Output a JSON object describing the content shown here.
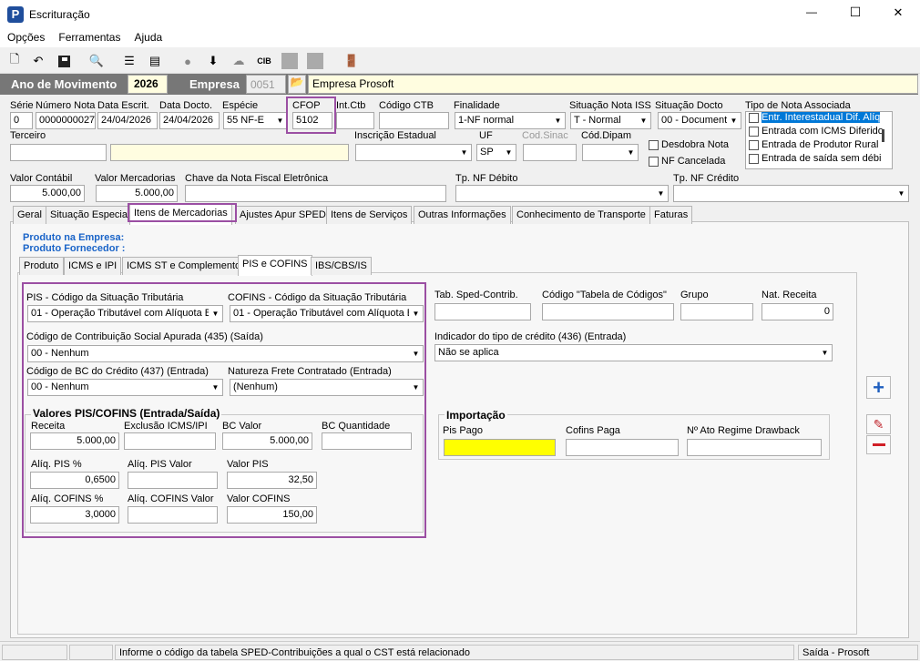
{
  "window": {
    "title": "Escrituração",
    "app_icon_letter": "P",
    "minimize": "—",
    "maximize": "☐",
    "close": "✕"
  },
  "menu": [
    "Opções",
    "Ferramentas",
    "Ajuda"
  ],
  "toolbar_icons": [
    "new-document-icon",
    "undo-icon",
    "save-icon",
    "print-preview-icon",
    "tree-icon",
    "report-icon",
    "apple-icon",
    "download-icon",
    "cloud-icon",
    "cib-icon",
    "panel-icon",
    "square-icon",
    "exit-door-icon"
  ],
  "header": {
    "ano_label": "Ano de Movimento",
    "ano_value": "2026",
    "empresa_label": "Empresa",
    "empresa_code": "0051",
    "empresa_name": "Empresa Prosoft"
  },
  "doc": {
    "serie_label": "Série",
    "serie": "0",
    "numero_label": "Número Nota",
    "numero": "0000000027",
    "data_escrit_label": "Data Escrit.",
    "data_escrit": "24/04/2026",
    "data_docto_label": "Data Docto.",
    "data_docto": "24/04/2026",
    "especie_label": "Espécie",
    "especie": "55   NF-E",
    "cfop_label": "CFOP",
    "cfop": "5102",
    "intctb_label": "Int.Ctb",
    "intctb": "",
    "codctb_label": "Código CTB",
    "codctb": "",
    "finalidade_label": "Finalidade",
    "finalidade": "1-NF normal",
    "situacao_iss_label": "Situação Nota ISS",
    "situacao_iss": "T - Normal",
    "situacao_docto_label": "Situação Docto",
    "situacao_docto": "00 - Document",
    "tipo_nota_label": "Tipo de Nota Associada",
    "tipo_nota_items": [
      "Entr. Interestadual Dif. Alíq",
      "Entrada com ICMS Diferido",
      "Entrada de Produtor Rural",
      "Entrada de saída sem débi"
    ],
    "terceiro_label": "Terceiro",
    "inscricao_label": "Inscrição Estadual",
    "uf_label": "UF",
    "uf": "SP",
    "codsinac_label": "Cod.Sinac",
    "coddipam_label": "Cód.Dipam",
    "desdobra_label": "Desdobra Nota",
    "cancelada_label": "NF Cancelada",
    "valor_contabil_label": "Valor Contábil",
    "valor_contabil": "5.000,00",
    "valor_merc_label": "Valor Mercadorias",
    "valor_merc": "5.000,00",
    "chave_label": "Chave da Nota Fiscal Eletrônica",
    "tp_debito_label": "Tp. NF Débito",
    "tp_credito_label": "Tp. NF Crédito"
  },
  "main_tabs": [
    "Geral",
    "Situação Especial",
    "Itens de Mercadorias",
    "Ajustes Apur SPED",
    "Itens de Serviços",
    "Outras Informações",
    "Conhecimento de Transporte",
    "Faturas"
  ],
  "produto_empresa": "Produto na Empresa:",
  "produto_fornecedor": "Produto Fornecedor :",
  "sub_tabs": [
    "Produto",
    "ICMS e IPI",
    "ICMS ST e Complemento",
    "PIS e COFINS",
    "IBS/CBS/IS"
  ],
  "pis": {
    "pis_cst_label": "PIS - Código da Situação Tributária",
    "pis_cst": "01 - Operação Tributável com Alíquota B",
    "cofins_cst_label": "COFINS - Código da Situação Tributária",
    "cofins_cst": "01 - Operação Tributável com Alíquota B",
    "contrib_label": "Código de Contribuição Social Apurada (435)    (Saída)",
    "contrib": "00 - Nenhum",
    "bc_credito_label": "Código de BC do Crédito (437) (Entrada)",
    "bc_credito": "00 - Nenhum",
    "natureza_label": "Natureza Frete Contratado  (Entrada)",
    "natureza": "(Nenhum)",
    "valores_title": "Valores PIS/COFINS (Entrada/Saída)",
    "receita_label": "Receita",
    "receita": "5.000,00",
    "exclusao_label": "Exclusão ICMS/IPI",
    "exclusao": "",
    "bc_valor_label": "BC Valor",
    "bc_valor": "5.000,00",
    "bc_qtd_label": "BC Quantidade",
    "bc_qtd": "",
    "aliq_pis_label": "Alíq. PIS %",
    "aliq_pis": "0,6500",
    "aliq_pis_valor_label": "Alíq. PIS Valor",
    "aliq_pis_valor": "",
    "valor_pis_label": "Valor PIS",
    "valor_pis": "32,50",
    "aliq_cofins_label": "Alíq. COFINS %",
    "aliq_cofins": "3,0000",
    "aliq_cofins_valor_label": "Alíq. COFINS Valor",
    "aliq_cofins_valor": "",
    "valor_cofins_label": "Valor COFINS",
    "valor_cofins": "150,00",
    "tab_sped_label": "Tab. Sped-Contrib.",
    "codigo_tabela_label": "Código \"Tabela de Códigos\"",
    "grupo_label": "Grupo",
    "nat_receita_label": "Nat. Receita",
    "nat_receita": "0",
    "indicador_label": "Indicador do tipo de crédito (436)    (Entrada)",
    "indicador": "Não se aplica",
    "importacao_title": "Importação",
    "pis_pago_label": "Pis Pago",
    "cofins_paga_label": "Cofins Paga",
    "ato_label": "Nº Ato Regime Drawback"
  },
  "status": {
    "message": "Informe o código da tabela SPED-Contribuições a qual o CST está relacionado",
    "right": "Saída - Prosoft"
  }
}
